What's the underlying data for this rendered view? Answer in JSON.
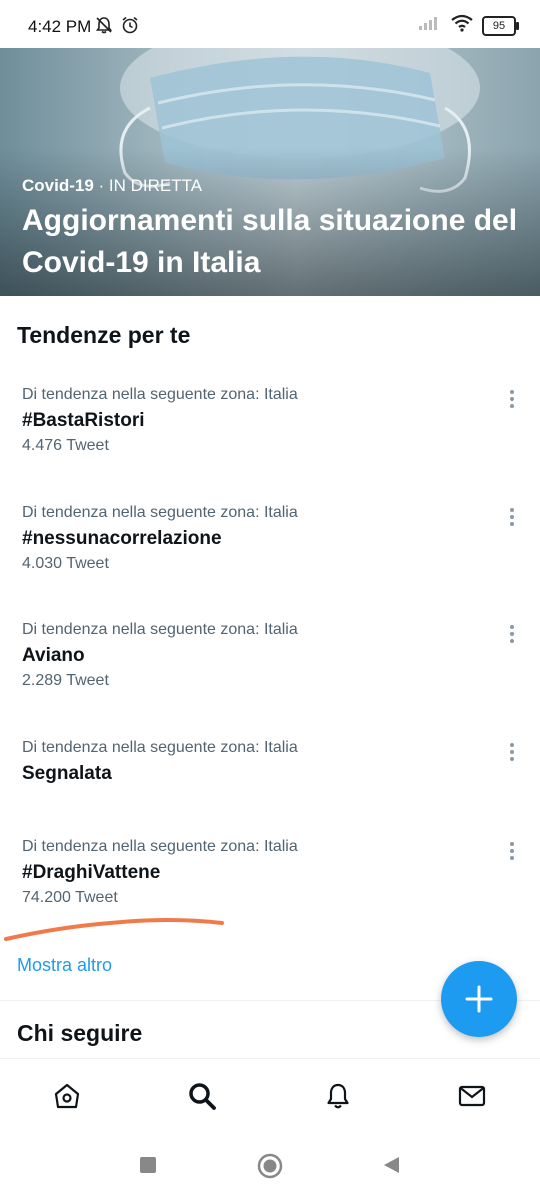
{
  "status_bar": {
    "time": "4:42 PM",
    "battery": "95"
  },
  "hero": {
    "category": "Covid-19",
    "separator": " · ",
    "live_label": "IN DIRETTA",
    "title": "Aggiornamenti sulla situazione del Covid-19 in Italia"
  },
  "trends_section": {
    "title": "Tendenze per te"
  },
  "trends": [
    {
      "context": "Di tendenza nella seguente zona: Italia",
      "name": "#BastaRistori",
      "count": "4.476 Tweet"
    },
    {
      "context": "Di tendenza nella seguente zona: Italia",
      "name": "#nessunacorrelazione",
      "count": "4.030 Tweet"
    },
    {
      "context": "Di tendenza nella seguente zona: Italia",
      "name": "Aviano",
      "count": "2.289 Tweet"
    },
    {
      "context": "Di tendenza nella seguente zona: Italia",
      "name": "Segnalata",
      "count": ""
    },
    {
      "context": "Di tendenza nella seguente zona: Italia",
      "name": "#DraghiVattene",
      "count": "74.200 Tweet"
    }
  ],
  "show_more": "Mostra altro",
  "who_to_follow": {
    "title": "Chi seguire"
  },
  "colors": {
    "accent": "#1d9bf0",
    "annotation": "#f07a4a",
    "secondary_text": "#536471"
  },
  "bottom_nav": {
    "items": [
      {
        "icon": "home-icon",
        "active": false
      },
      {
        "icon": "search-icon",
        "active": true
      },
      {
        "icon": "bell-icon",
        "active": false
      },
      {
        "icon": "mail-icon",
        "active": false
      }
    ]
  }
}
